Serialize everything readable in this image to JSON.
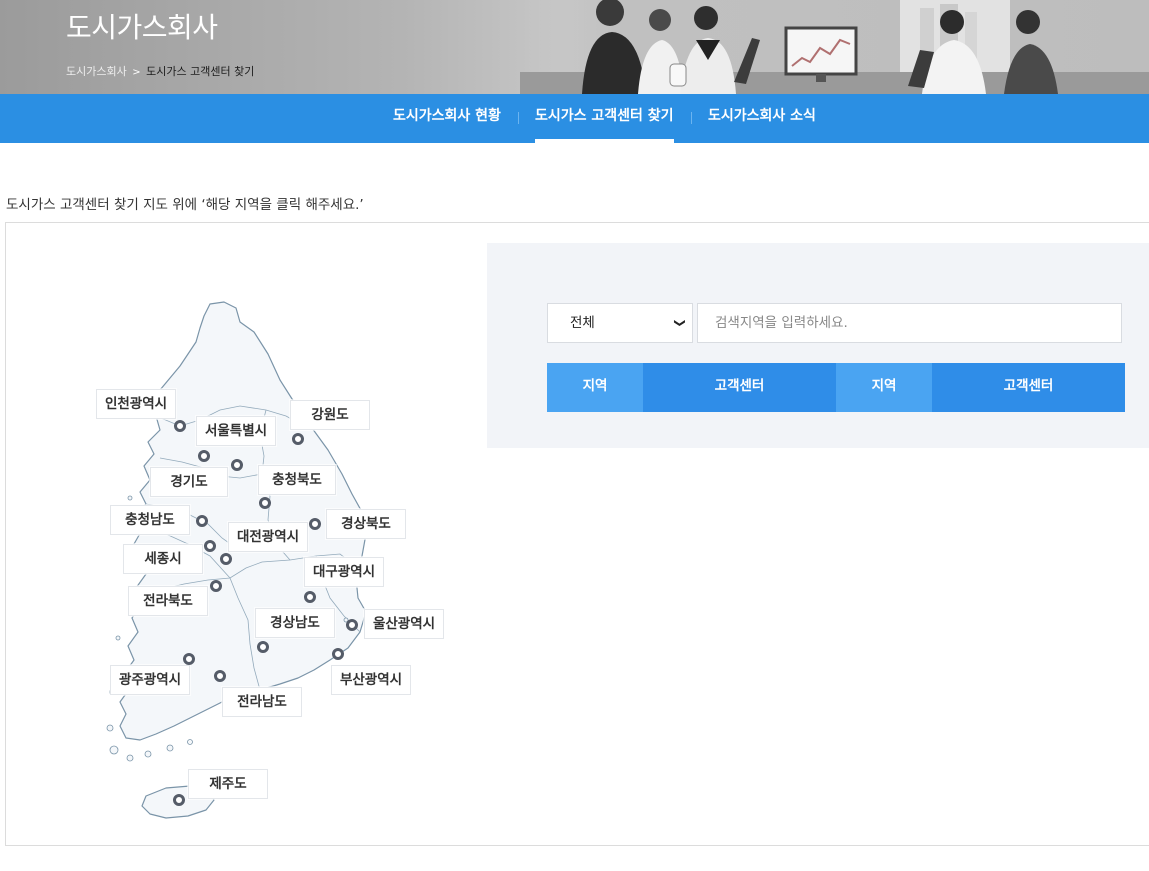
{
  "header": {
    "title": "도시가스회사",
    "breadcrumb": {
      "home": "도시가스회사",
      "separator": ">",
      "current": "도시가스 고객센터 찾기"
    }
  },
  "nav": {
    "items": [
      {
        "label": "도시가스회사 현황",
        "active": false
      },
      {
        "label": "도시가스 고객센터 찾기",
        "active": true
      },
      {
        "label": "도시가스회사 소식",
        "active": false
      }
    ]
  },
  "instruction": "도시가스 고객센터 찾기 지도 위에 ‘해당 지역을 클릭 해주세요.’",
  "map": {
    "regions": [
      {
        "label": "인천광역시"
      },
      {
        "label": "서울특별시"
      },
      {
        "label": "강원도"
      },
      {
        "label": "경기도"
      },
      {
        "label": "충청북도"
      },
      {
        "label": "충청남도"
      },
      {
        "label": "경상북도"
      },
      {
        "label": "대전광역시"
      },
      {
        "label": "세종시"
      },
      {
        "label": "대구광역시"
      },
      {
        "label": "전라북도"
      },
      {
        "label": "경상남도"
      },
      {
        "label": "울산광역시"
      },
      {
        "label": "광주광역시"
      },
      {
        "label": "부산광역시"
      },
      {
        "label": "전라남도"
      },
      {
        "label": "제주도"
      }
    ]
  },
  "search": {
    "select_value": "전체",
    "input_placeholder": "검색지역을 입력하세요.",
    "table_headers": [
      "지역",
      "고객센터",
      "지역",
      "고객센터"
    ]
  },
  "colors": {
    "nav_bg": "#2b8fe3",
    "header_light": "#4aa4f2",
    "header_dark": "#2f8de8",
    "panel_bg": "#f2f4f8",
    "map_fill": "#f4f7fa",
    "map_stroke": "#7a94a8"
  }
}
